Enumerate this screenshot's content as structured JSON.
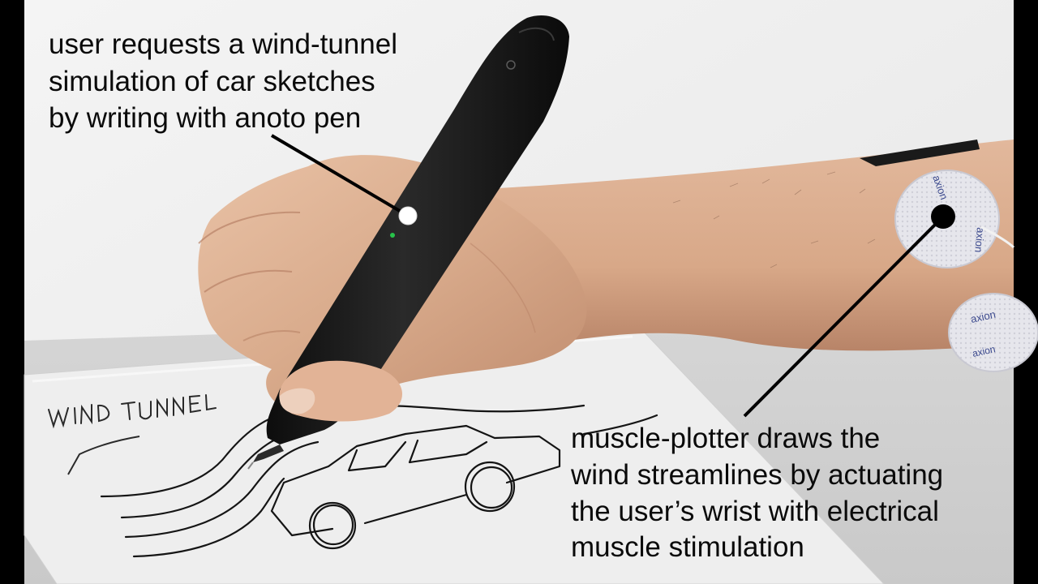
{
  "annotations": {
    "top": {
      "lines": [
        "user requests a wind-tunnel",
        "simulation of car sketches",
        "by writing with anoto pen"
      ]
    },
    "bottom": {
      "lines": [
        "muscle-plotter draws the",
        "wind streamlines by actuating",
        "the user’s wrist with electrical",
        "muscle stimulation"
      ]
    }
  },
  "photo": {
    "handwritten_text": "WIND TUNNEL",
    "electrode_brand": "axion",
    "colors": {
      "wall": "#ececec",
      "skin": "#dcae90",
      "pen": "#1b1b1b",
      "electrode": "#e4e4ea",
      "callout_line": "#000000",
      "callout_dot": "#ffffff"
    }
  }
}
